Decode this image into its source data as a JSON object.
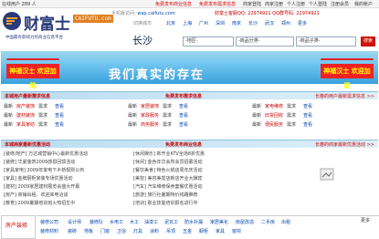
{
  "topbar": {
    "online": "在线用户 289 人",
    "links": [
      "免费发布商业信息",
      "免费发布需求信息",
      "商家登陆",
      "商家注册",
      "个人注册",
      "个人登陆",
      "注册会员",
      "我的帐户"
    ]
  },
  "logo": {
    "name": "财富士",
    "domain": "CAIFUTU.com",
    "slogan": "中国最有影响力的商业信息平台"
  },
  "contact": {
    "mobile_label": "手机版访问:",
    "mobile_url": "wap.caifutu.com",
    "hotline": "财富士客服QQ: 22974921  QQ群号码: 22974921"
  },
  "city_bar": {
    "prefix": "切换城市",
    "cities": [
      "北京",
      "上海",
      "广州",
      "深圳",
      "南京",
      "长沙",
      "武汉",
      "郑州",
      "更多"
    ]
  },
  "search": {
    "city": "长沙",
    "select1": "-地区-",
    "select2": "-商品分类-",
    "select3": "-商品子类-",
    "button": "搜索"
  },
  "banners": {
    "left": "神福汉士  欢迎加盟",
    "right": "神福汉士  欢迎加盟",
    "main": "我们真实的存在"
  },
  "section1": {
    "title": "本城用户最新需求信息",
    "center": "免费发布需求信息",
    "right": "长春的用户最新需求信息 >>"
  },
  "demand_rows": [
    [
      "最新",
      "房产装饰",
      "需求",
      "查看",
      "最新",
      "家居装饰",
      "需求",
      "查看",
      "最新",
      "家电维修",
      "需求",
      "查看"
    ],
    [
      "最新",
      "建材装饰",
      "需求",
      "查看",
      "最新",
      "家政服务",
      "需求",
      "查看",
      "最新",
      "旧货回收",
      "需求",
      "查看"
    ],
    [
      "最新",
      "家具家纺",
      "需求",
      "查看",
      "最新",
      "商务服务",
      "需求",
      "查看",
      "最新",
      "便民服务",
      "需求",
      "查看"
    ]
  ],
  "section2": {
    "title": "本城商家最新优惠活动",
    "center": "免费发布商业信息",
    "right": "长春的商家最新优惠活动 >>"
  },
  "news_left": [
    "[装修/地产] 万达城营销中心最新优惠活动",
    "[装修] 华夏装饰2009感恩回馈活动",
    "[家具家电] 2009年家电下乡新规则公布",
    "[家具] 金牌厨柜家装专场优惠活动",
    "[建材] 2009家居建材展览会盛大开幕",
    "[房产] 商铺出租，欢迎来电洽谈",
    "[教育] 2009暑期培训班火热招生中"
  ],
  "news_right": [
    "[休闲娱乐] 新开业KTV全场8折优惠",
    "[休闲] 金色年华会所会员招募活动",
    "[餐饮美食] 特色火锅店周年庆活动",
    "[美容] 美容美发店新店开业大酬宾",
    "[汽车] 汽车维修保养套餐优惠活动",
    "[旅游] 旅行社暑期特价线路推荐",
    "[培训] 职业技能培训报名进行中"
  ],
  "bottom": {
    "category_tab": "房产装修",
    "row1": [
      "装修公司",
      "设计师",
      "装修队",
      "水电工",
      "木工",
      "油漆工",
      "泥瓦工",
      "防水补漏",
      "家居美化",
      "房屋改造",
      "二手房",
      "出租"
    ],
    "row2": [
      "装修材料",
      "瓷砖",
      "地板",
      "门窗",
      "卫浴",
      "灯具",
      "涂料",
      "吊顶",
      "五金",
      "橱柜",
      "家具",
      "窗帘"
    ],
    "side": "更多"
  }
}
